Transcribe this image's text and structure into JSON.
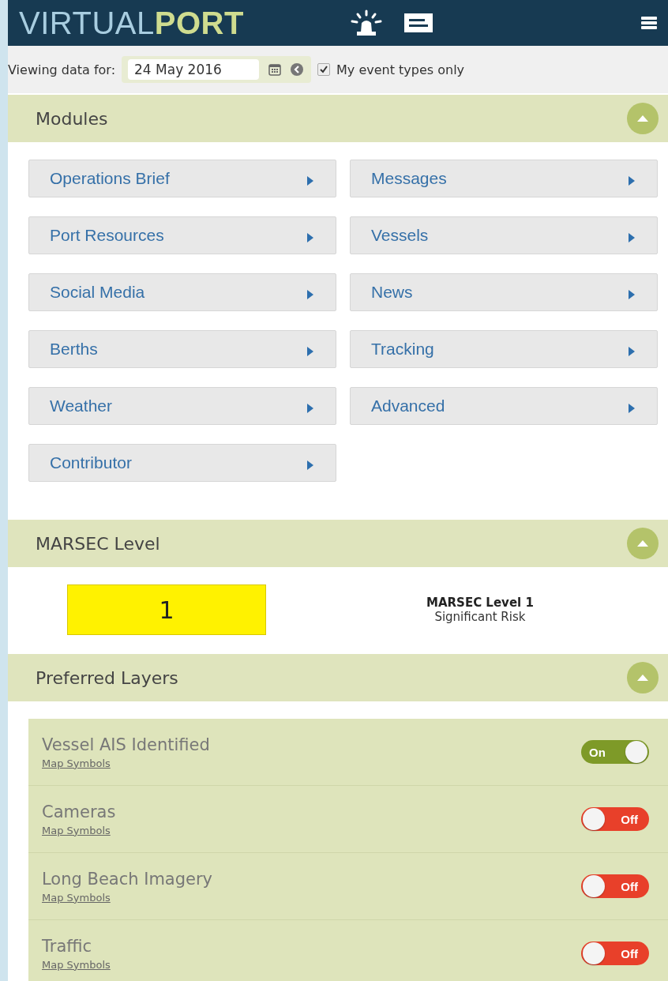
{
  "header": {
    "logo_light": "VIRTUAL",
    "logo_bold": "PORT"
  },
  "toolbar": {
    "label": "Viewing data for:",
    "date": "24 May 2016",
    "filter_checked": true,
    "filter_label": "My event types only"
  },
  "modules": {
    "title": "Modules",
    "expanded": true,
    "items": [
      {
        "label": "Operations Brief"
      },
      {
        "label": "Messages"
      },
      {
        "label": "Port Resources"
      },
      {
        "label": "Vessels"
      },
      {
        "label": "Social Media"
      },
      {
        "label": "News"
      },
      {
        "label": "Berths"
      },
      {
        "label": "Tracking"
      },
      {
        "label": "Weather"
      },
      {
        "label": "Advanced"
      },
      {
        "label": "Contributor"
      }
    ]
  },
  "marsec": {
    "title": "MARSEC Level",
    "expanded": true,
    "level_value": "1",
    "color": "#fff200",
    "heading": "MARSEC Level 1",
    "description": "Significant Risk"
  },
  "layers": {
    "title": "Preferred Layers",
    "expanded": true,
    "items": [
      {
        "name": "Vessel AIS Identified",
        "link": "Map Symbols",
        "on": true,
        "toggle_label": "On"
      },
      {
        "name": "Cameras",
        "link": "Map Symbols",
        "on": false,
        "toggle_label": "Off"
      },
      {
        "name": "Long Beach Imagery",
        "link": "Map Symbols",
        "on": false,
        "toggle_label": "Off"
      },
      {
        "name": "Traffic",
        "link": "Map Symbols",
        "on": false,
        "toggle_label": "Off"
      }
    ]
  }
}
